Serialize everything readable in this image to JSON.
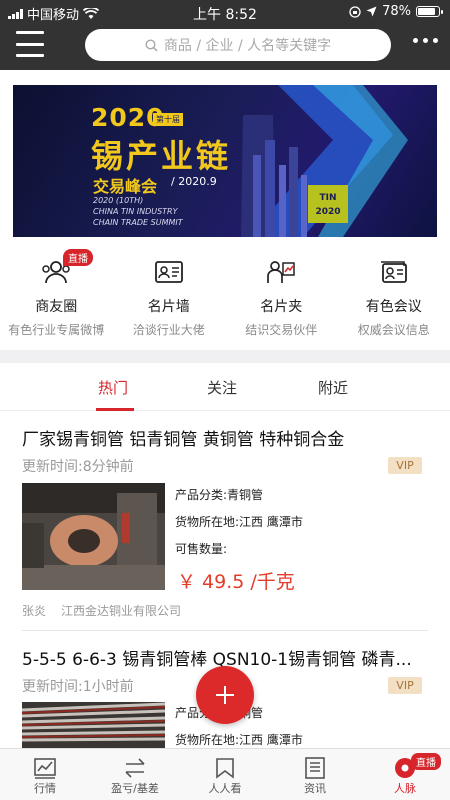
{
  "status_bar": {
    "carrier": "中国移动",
    "time": "上午 8:52",
    "battery": "78%"
  },
  "header": {
    "search_placeholder": "商品 / 企业 / 人名等关键字"
  },
  "banner": {
    "year": "2020",
    "edition": "第十届",
    "title": "锡产业链",
    "subtitle": "交易峰会",
    "date": "/ 2020.9",
    "english": [
      "2020 (10TH)",
      "CHINA TIN INDUSTRY",
      "CHAIN TRADE SUMMIT"
    ],
    "logo_text": "TIN",
    "logo_year": "2020"
  },
  "quick_entries": [
    {
      "title": "商友圈",
      "desc": "有色行业专属微博",
      "icon": "friends-icon",
      "badge": "直播"
    },
    {
      "title": "名片墙",
      "desc": "洽谈行业大佬",
      "icon": "card-wall-icon"
    },
    {
      "title": "名片夹",
      "desc": "结识交易伙伴",
      "icon": "card-holder-icon"
    },
    {
      "title": "有色会议",
      "desc": "权威会议信息",
      "icon": "meeting-icon"
    }
  ],
  "tabs": [
    {
      "label": "热门",
      "active": true
    },
    {
      "label": "关注",
      "active": false
    },
    {
      "label": "附近",
      "active": false
    }
  ],
  "listings": [
    {
      "title": "厂家锡青铜管 铝青铜管 黄铜管 特种铜合金",
      "update_time": "更新时间:8分钟前",
      "vip": "VIP",
      "category": "产品分类:青铜管",
      "location": "货物所在地:江西 鹰潭市",
      "quantity_label": "可售数量:",
      "price": "￥ 49.5 /千克",
      "seller": "张炎",
      "company": "江西金达铜业有限公司"
    },
    {
      "title": "5-5-5 6-6-3 锡青铜管棒 QSN10-1锡青铜管 磷青...",
      "update_time": "更新时间:1小时前",
      "vip": "VIP",
      "category": "产品分类:青铜管",
      "location": "货物所在地:江西 鹰潭市"
    }
  ],
  "bottom_nav": [
    {
      "label": "行情",
      "icon": "chart-icon"
    },
    {
      "label": "盈亏/基差",
      "icon": "profit-icon"
    },
    {
      "label": "人人看",
      "icon": "bookmark-icon"
    },
    {
      "label": "资讯",
      "icon": "news-icon"
    },
    {
      "label": "人脉",
      "icon": "contacts-icon",
      "active": true,
      "badge": "直播"
    }
  ],
  "colors": {
    "accent": "#d7262b",
    "header_bg": "#333333",
    "vip_bg": "#f3dfc3",
    "price": "#e33d2a"
  }
}
